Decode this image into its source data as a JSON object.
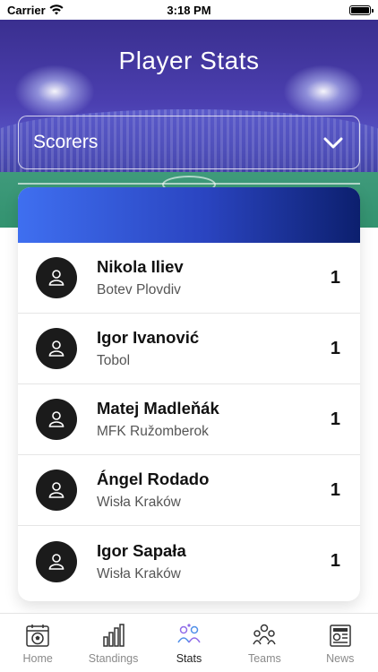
{
  "status_bar": {
    "carrier": "Carrier",
    "time": "3:18 PM"
  },
  "header": {
    "title": "Player Stats"
  },
  "filter": {
    "selected": "Scorers"
  },
  "players": [
    {
      "name": "Nikola Iliev",
      "team": "Botev Plovdiv",
      "goals": "1"
    },
    {
      "name": "Igor Ivanović",
      "team": "Tobol",
      "goals": "1"
    },
    {
      "name": "Matej Madleňák",
      "team": "MFK Ružomberok",
      "goals": "1"
    },
    {
      "name": "Ángel Rodado",
      "team": "Wisła Kraków",
      "goals": "1"
    },
    {
      "name": "Igor Sapała",
      "team": "Wisła Kraków",
      "goals": "1"
    }
  ],
  "tabs": [
    {
      "label": "Home",
      "icon": "soccer-ball-calendar-icon"
    },
    {
      "label": "Standings",
      "icon": "bar-chart-icon"
    },
    {
      "label": "Stats",
      "icon": "players-stats-icon",
      "active": true
    },
    {
      "label": "Teams",
      "icon": "team-group-icon"
    },
    {
      "label": "News",
      "icon": "newspaper-icon"
    }
  ],
  "colors": {
    "hero_top": "#3a2f8f",
    "card_header_start": "#3f6ff0",
    "card_header_end": "#0c1f6e",
    "active_tab_accent": "#8f6be8"
  }
}
